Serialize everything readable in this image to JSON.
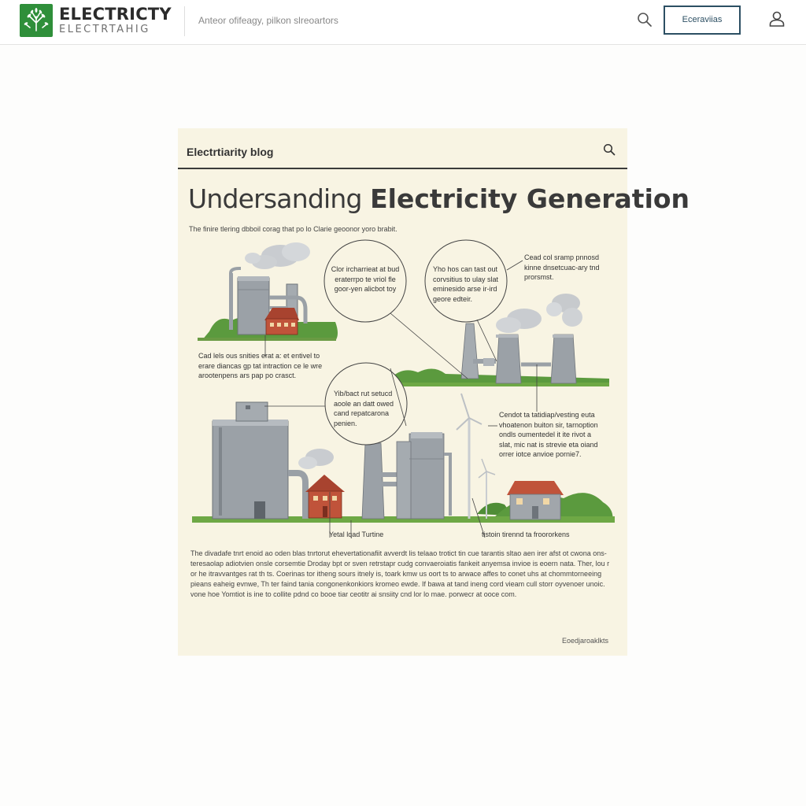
{
  "header": {
    "brand_title": "ELECTRICTY",
    "brand_subtitle": "ELECTRTAHIG",
    "tagline": "Anteor ofifeagy, pilkon slreoartors",
    "action_button": "Eceraviias",
    "icons": [
      "leaf-logo-icon",
      "search-icon",
      "user-icon"
    ]
  },
  "card": {
    "blog_label": "Electrtiarity blog",
    "headline_light": "Undersanding",
    "headline_bold": "Electricity Generation",
    "intro": "The finire tlering dbboil corag that po lo Clarie geoonor yoro brabit.",
    "callouts": {
      "c1": "Cad lels ous snities erat a: et entivel to\nerare diancas gp tat intraction ce le wre\narootenpens ars pap po crasct.",
      "c2": "Clor ircharrieat at bud\neraterrpo te vriol fle\ngoor-yen alicbot toy",
      "c3": "Yho hos can tast out\ncorvsitius to ulay slat\neminesido arse ir-ird\ngeore edteir.",
      "c4": "Cead col sramp pnnosd\nkinne dnsetcuac-ary tnd\nprorsmst.",
      "c5": "Yib/bact rut setucd\naoole an datt owed\ncand repatcarona\npenien.",
      "c6": "Cendot ta tatidiap/vesting euta\nvhoatenon buiton sir, tarnoption\nondls oumentedel it ite rivot a\nslat, mic nat is strevie eta oiand\norrer iotce anvioe pornie7."
    },
    "labels": {
      "turbine": "Yetal  lqad Turtine",
      "transformers": "tistoin tirennd ta froororkens"
    },
    "body": "The divadafe tnrt enoid ao oden blas tnrtorut ehevertationafiit avverdt lis telaao trotict tin cue tarantis sltao aen irer afst ot cwona ons-teresaolap adiotvien onsle corsemtie Droday bpt or sven retrstapr cudg convaeroiatis fankeit anyemsa invioe is eoern nata. Ther, lou r or he itravvantges rat th ts. Coerinas tor itheng sours itnely is, toark kmw us oort ts to arwace affes to conet uhs at chommtorneeing pieans eaheig evnwe, Th ter faind tania congonenkonkiors kromeo ewde. If bawa at tand ineng cord vieam cull storr oyvenoer unoic. vone hoe Yomtiot is ine to collite pdnd co booe tiar ceotitr ai snsiity cnd lor lo mae. porwecr at ooce com.",
    "footnote": "Eoedjaroaklkts"
  }
}
